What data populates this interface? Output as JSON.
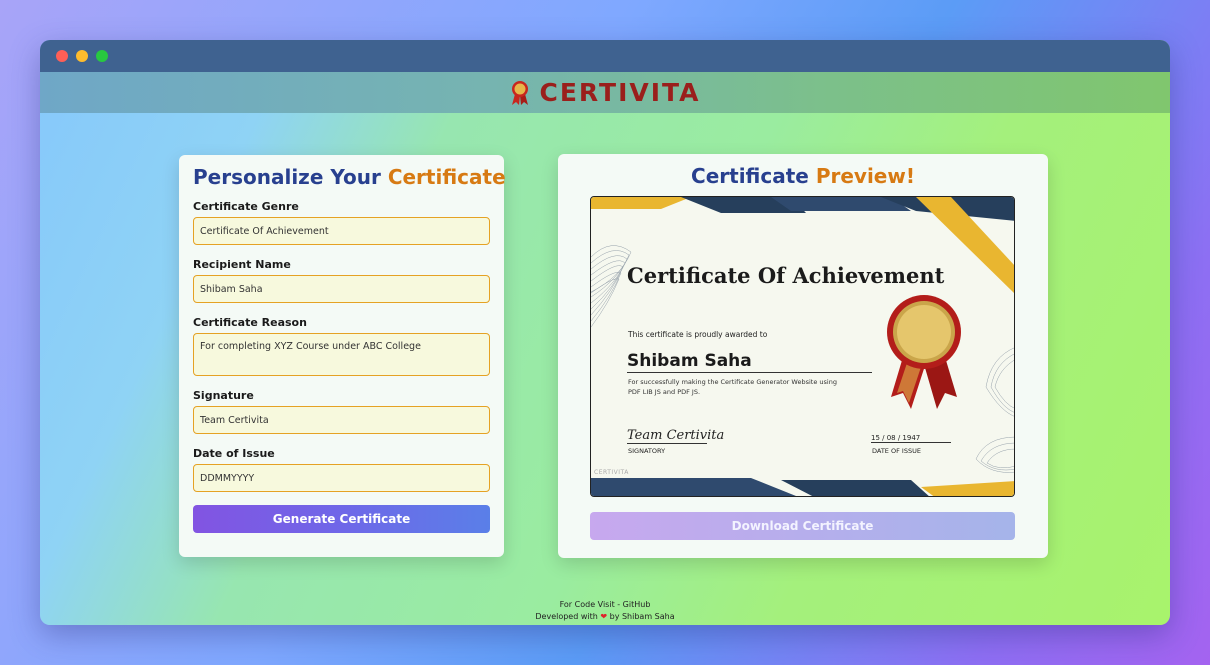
{
  "app": {
    "brand": "CERTIVITA"
  },
  "form": {
    "title_part1": "Personalize Your",
    "title_part2": "Certificate",
    "fields": [
      {
        "label": "Certificate Genre",
        "value": "Certificate Of Achievement"
      },
      {
        "label": "Recipient Name",
        "value": "Shibam Saha"
      },
      {
        "label": "Certificate Reason",
        "value": "For completing XYZ Course under ABC College"
      },
      {
        "label": "Signature",
        "value": "Team Certivita"
      },
      {
        "label": "Date of Issue",
        "value": "DDMMYYYY"
      }
    ],
    "generate_button": "Generate Certificate"
  },
  "preview": {
    "title_part1": "Certificate",
    "title_part2": "Preview!",
    "certificate": {
      "heading": "Certificate Of Achievement",
      "awarded_text": "This certificate is proudly awarded to",
      "recipient": "Shibam Saha",
      "reason": "For successfully making the Certificate Generator Website using PDF LIB JS and PDF JS.",
      "signature": "Team Certivita",
      "signature_label": "SIGNATORY",
      "date": "15 / 08 / 1947",
      "date_label": "DATE OF ISSUE",
      "watermark": "CERTIVITA"
    },
    "download_button": "Download Certificate"
  },
  "footer": {
    "line1": "For Code Visit - GitHub",
    "line2_prefix": "Developed with",
    "heart": "❤",
    "line2_suffix": "by Shibam Saha"
  },
  "colors": {
    "brand_red": "#9a1f1c",
    "title_blue": "#28408f",
    "title_orange": "#d77a13",
    "input_border": "#e5a224"
  }
}
